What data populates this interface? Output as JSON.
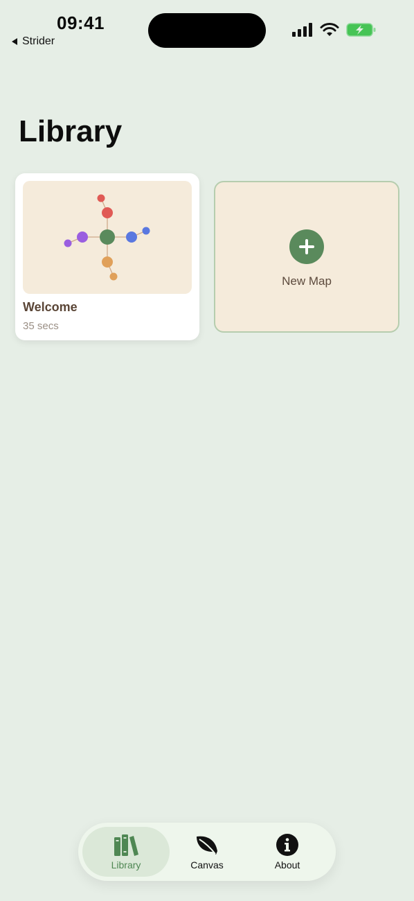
{
  "status_bar": {
    "time": "09:41",
    "back_app": "Strider"
  },
  "page": {
    "title": "Library"
  },
  "maps": [
    {
      "name": "Welcome",
      "time": "35 secs"
    }
  ],
  "new_map": {
    "label": "New Map"
  },
  "tabs": [
    {
      "label": "Library",
      "active": true,
      "icon": "books-icon"
    },
    {
      "label": "Canvas",
      "active": false,
      "icon": "leaf-icon"
    },
    {
      "label": "About",
      "active": false,
      "icon": "info-icon"
    }
  ],
  "colors": {
    "background": "#e6eee6",
    "accent": "#5a8a5c",
    "card_thumb": "#f5ebdb",
    "node_center": "#5a8a5c",
    "node_red": "#e05a55",
    "node_purple": "#9a5ee0",
    "node_blue": "#5a78e0",
    "node_orange": "#e0a05a"
  }
}
